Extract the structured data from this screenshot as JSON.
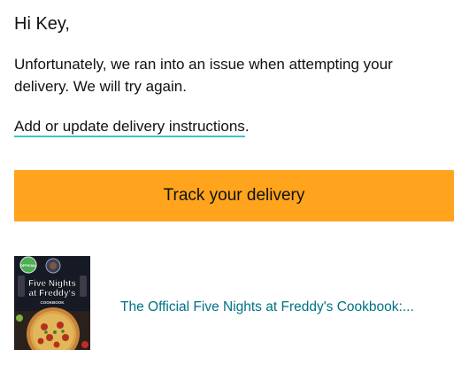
{
  "email": {
    "greeting": "Hi Key,",
    "message": "Unfortunately, we ran into an issue when attempting your delivery. We will try again.",
    "instructions_link": "Add or update delivery instructions",
    "instructions_suffix": ".",
    "track_button": "Track your delivery"
  },
  "product": {
    "title": "The Official Five Nights at Freddy's Cookbook:...",
    "cover_title_line1": "Five Nights",
    "cover_title_line2": "at Freddy's",
    "cover_subtitle": "COOKBOOK",
    "cover_badge": "OFFICIAL"
  },
  "colors": {
    "accent_button": "#ffa41c",
    "link_underline": "#3fc4c9",
    "product_link": "#007185"
  }
}
